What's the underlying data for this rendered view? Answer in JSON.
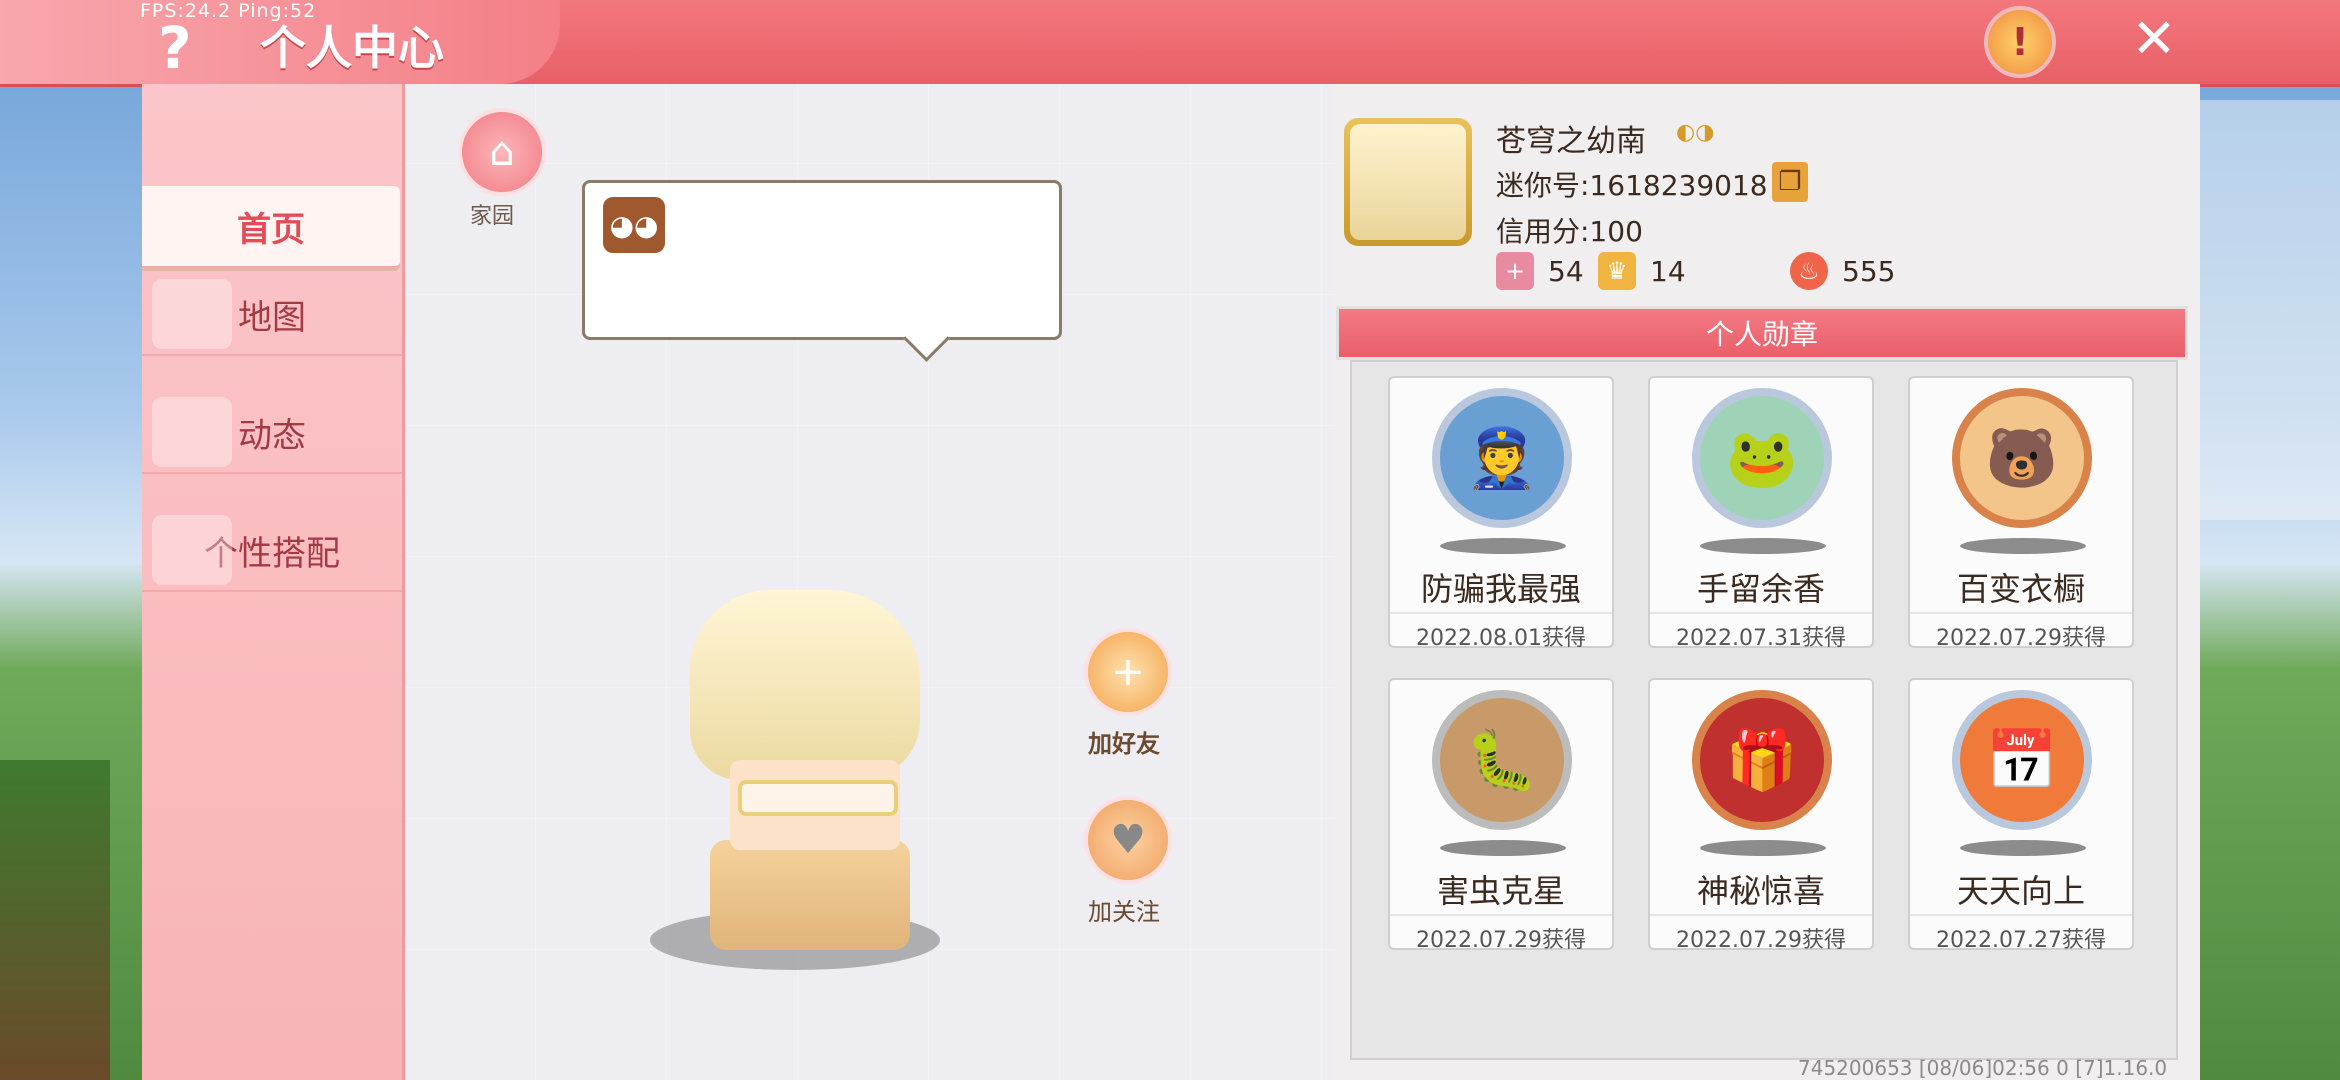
{
  "overlay": {
    "fps": "FPS:24.2  Ping:52"
  },
  "header": {
    "help_icon": "?",
    "title": "个人中心",
    "warning_icon": "warning-icon",
    "close_icon": "✕"
  },
  "sidebar": {
    "items": [
      {
        "label": "首页",
        "active": true
      },
      {
        "label": "地图",
        "active": false
      },
      {
        "label": "动态",
        "active": false
      },
      {
        "label": "个性搭配",
        "active": false
      }
    ]
  },
  "home": {
    "label": "家园"
  },
  "actions": {
    "add_friend": "加好友",
    "follow": "加关注"
  },
  "profile": {
    "nickname": "苍穹之幼南",
    "mini_id": "迷你号:1618239018",
    "credit": "信用分:100",
    "stats": [
      {
        "icon": "bookmark-plus-icon",
        "value": "54"
      },
      {
        "icon": "fans-icon",
        "value": "14"
      },
      {
        "icon": "flame-icon",
        "value": "555"
      }
    ]
  },
  "badges": {
    "header": "个人勋章",
    "items": [
      {
        "name": "防骗我最强",
        "date": "2022.08.01获得",
        "icon": "police-medal-icon"
      },
      {
        "name": "手留余香",
        "date": "2022.07.31获得",
        "icon": "frog-medal-icon"
      },
      {
        "name": "百变衣橱",
        "date": "2022.07.29获得",
        "icon": "wardrobe-medal-icon"
      },
      {
        "name": "害虫克星",
        "date": "2022.07.29获得",
        "icon": "bug-medal-icon"
      },
      {
        "name": "神秘惊喜",
        "date": "2022.07.29获得",
        "icon": "gift-medal-icon"
      },
      {
        "name": "天天向上",
        "date": "2022.07.27获得",
        "icon": "calendar-medal-icon"
      }
    ]
  },
  "footer": {
    "info": "745200653    [08/06]02:56 0  [7]1.16.0"
  },
  "colors": {
    "accent": "#ea5f6a",
    "sidebar_bg": "#f8b4b8",
    "panel_bg": "#ededf2"
  }
}
